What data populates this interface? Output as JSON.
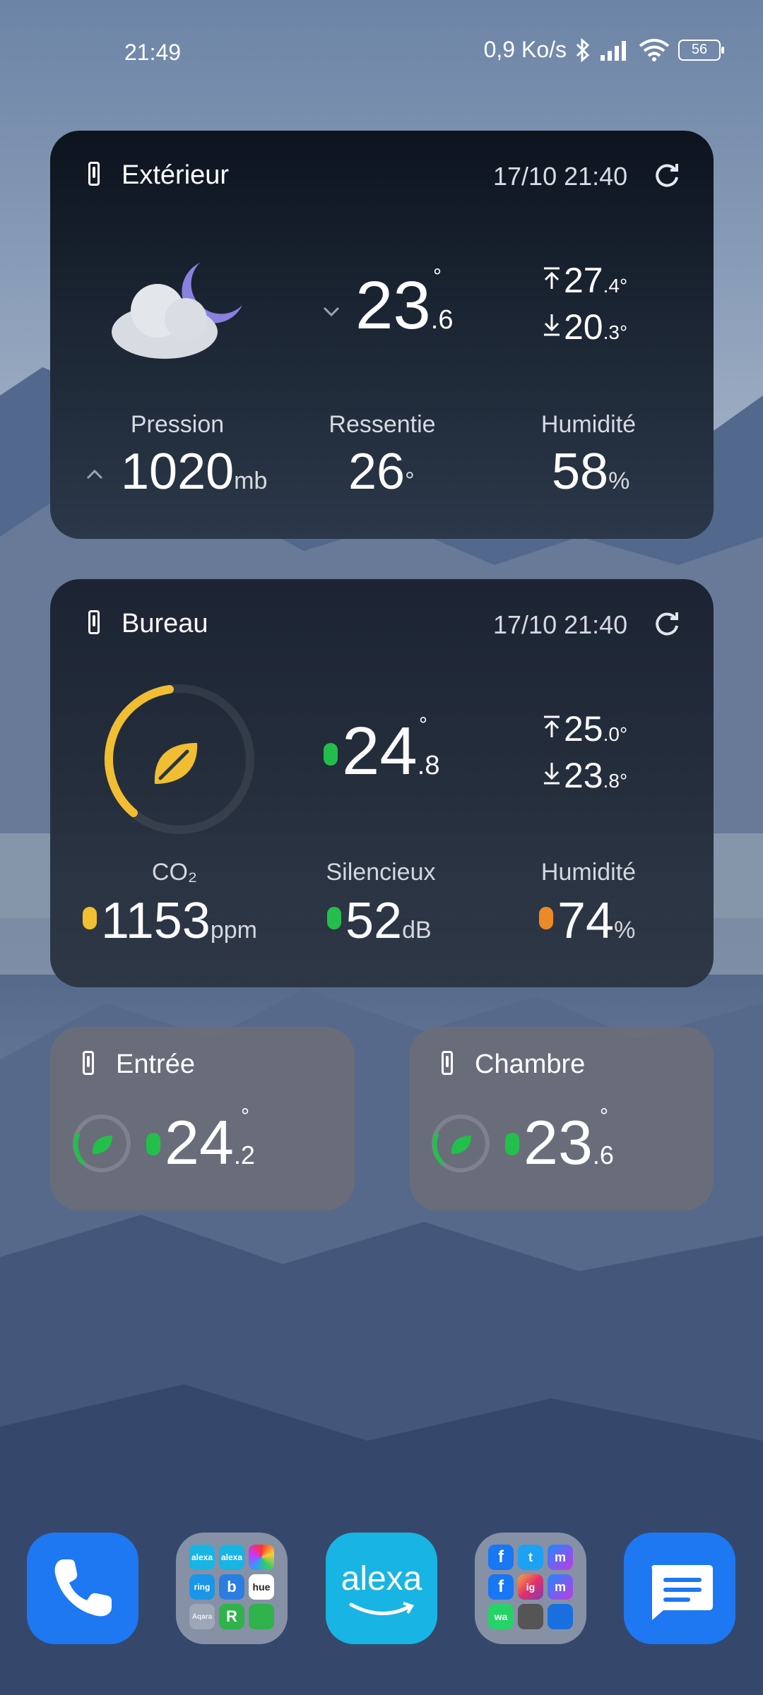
{
  "status_bar": {
    "time": "21:49",
    "net_speed": "0,9 Ko/s",
    "battery": "56"
  },
  "colors": {
    "accent_yellow": "#f6c12e",
    "ok_green": "#22c04a",
    "warn_orange": "#f08a24",
    "dock_blue": "#1d78f2",
    "alexa_teal": "#18b4e4"
  },
  "exterieur": {
    "title": "Extérieur",
    "updated": "17/10 21:40",
    "weather_icon": "cloud-moon-icon",
    "trend": "down",
    "temp_int": "23",
    "temp_dec": ".6",
    "deg": "°",
    "max_int": "27",
    "max_dec": ".4°",
    "min_int": "20",
    "min_dec": ".3°",
    "pression_label": "Pression",
    "pression_value": "1020",
    "pression_unit": "mb",
    "ressentie_label": "Ressentie",
    "ressentie_value": "26",
    "ressentie_unit": "°",
    "humidite_label": "Humidité",
    "humidite_value": "58",
    "humidite_unit": "%"
  },
  "bureau": {
    "title": "Bureau",
    "updated": "17/10 21:40",
    "gauge_icon": "leaf-icon",
    "temp_int": "24",
    "temp_dec": ".8",
    "deg": "°",
    "max_int": "25",
    "max_dec": ".0°",
    "min_int": "23",
    "min_dec": ".8°",
    "co2_label": "CO₂",
    "co2_value": "1153",
    "co2_unit": "ppm",
    "bruit_label": "Silencieux",
    "bruit_value": "52",
    "bruit_unit": "dB",
    "humidite_label": "Humidité",
    "humidite_value": "74",
    "humidite_unit": "%"
  },
  "entree": {
    "title": "Entrée",
    "temp_int": "24",
    "temp_dec": ".2",
    "deg": "°"
  },
  "chambre": {
    "title": "Chambre",
    "temp_int": "23",
    "temp_dec": ".6",
    "deg": "°"
  },
  "dock": {
    "phone_icon": "phone-icon",
    "folder1": [
      "alexa",
      "alexa",
      "",
      "ring",
      "b",
      "hue",
      "Aqara",
      "R",
      ""
    ],
    "alexa_label": "alexa",
    "folder2": [
      "f",
      "t",
      "m",
      "f",
      "ig",
      "m",
      "wa",
      "",
      ""
    ],
    "messages_icon": "messages-icon"
  }
}
